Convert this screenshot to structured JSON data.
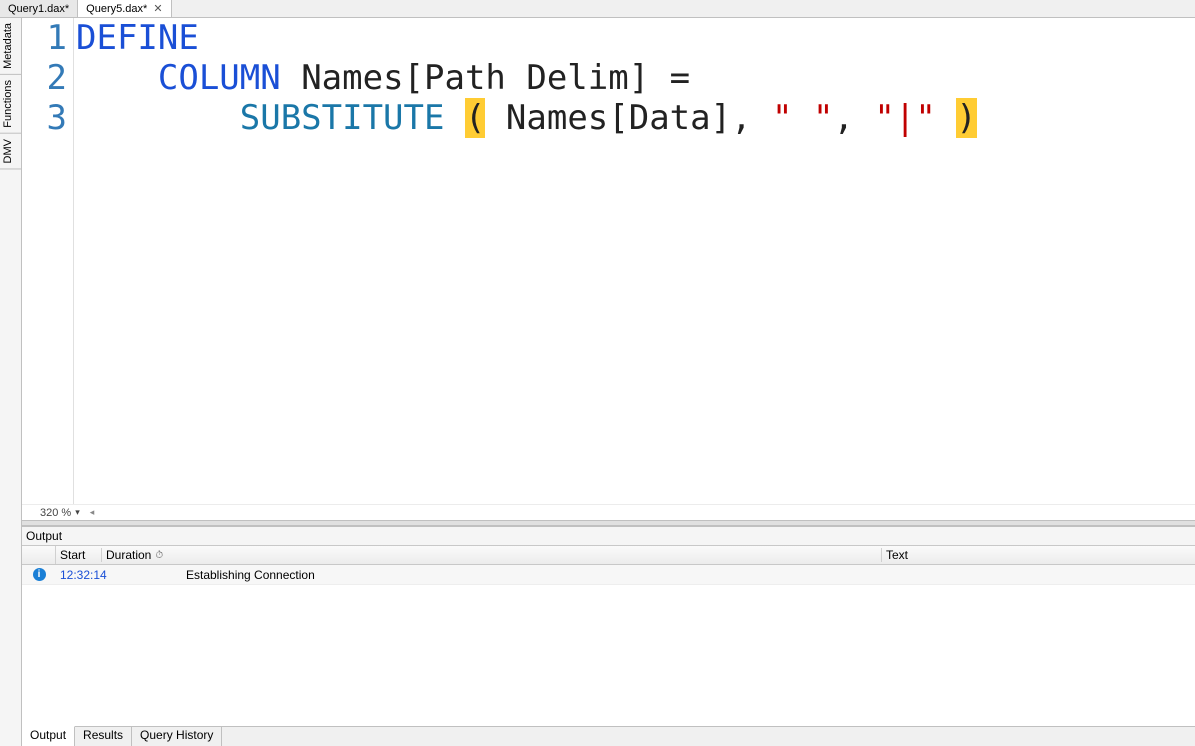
{
  "tabs": {
    "file1": "Query1.dax*",
    "file2": "Query5.dax*",
    "close": "✕"
  },
  "sidetabs": {
    "metadata": "Metadata",
    "functions": "Functions",
    "dmv": "DMV"
  },
  "gutter": {
    "l1": "1",
    "l2": "2",
    "l3": "3"
  },
  "code": {
    "define": "DEFINE",
    "column_kw": "COLUMN",
    "column_rest": " Names[Path Delim] =",
    "indent3": "        ",
    "substitute": "SUBSTITUTE",
    "space1": " ",
    "lparen": "(",
    "args_mid": " Names[Data], ",
    "str1": "\" \"",
    "comma": ", ",
    "str2": "\"|\"",
    "space2": " ",
    "rparen": ")"
  },
  "status": {
    "zoom": "320 %",
    "arrow": "▾",
    "scroll": "◂"
  },
  "output": {
    "title": "Output",
    "columns": {
      "start": "Start",
      "duration": "Duration",
      "sort": "⏱",
      "text": "Text"
    },
    "rows": [
      {
        "start": "12:32:14",
        "duration": "",
        "text": "Establishing Connection"
      }
    ]
  },
  "bottomTabs": {
    "output": "Output",
    "results": "Results",
    "history": "Query History"
  }
}
